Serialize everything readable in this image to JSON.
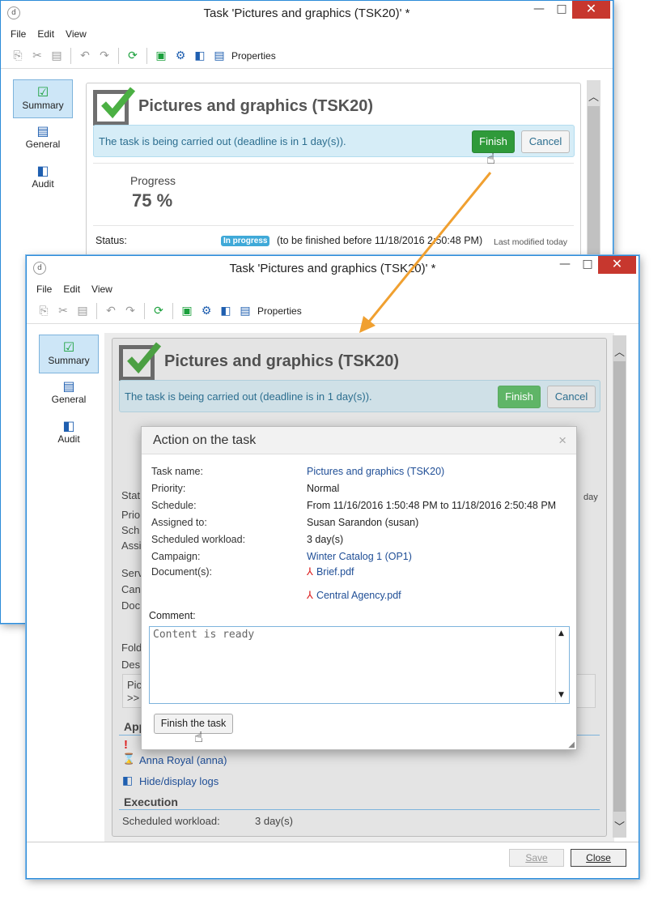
{
  "window_back": {
    "title": "Task 'Pictures and graphics (TSK20)' *",
    "menu": [
      "File",
      "Edit",
      "View"
    ],
    "toolbar_properties": "Properties",
    "sidebar": [
      {
        "label": "Summary"
      },
      {
        "label": "General"
      },
      {
        "label": "Audit"
      }
    ],
    "task_title": "Pictures and graphics (TSK20)",
    "info_text": "The task is being carried out (deadline is in 1 day(s)).",
    "finish_label": "Finish",
    "cancel_label": "Cancel",
    "progress_label": "Progress",
    "progress_value": "75 %",
    "status_label": "Status:",
    "status_badge": "In progress",
    "status_text": "(to be finished before 11/18/2016 2:50:48 PM)",
    "last_modified": "Last modified today",
    "minimize": "—",
    "maximize": "□",
    "close": "✕"
  },
  "window_front": {
    "title": "Task 'Pictures and graphics (TSK20)' *",
    "menu": [
      "File",
      "Edit",
      "View"
    ],
    "toolbar_properties": "Properties",
    "sidebar": [
      {
        "label": "Summary"
      },
      {
        "label": "General"
      },
      {
        "label": "Audit"
      }
    ],
    "task_title": "Pictures and graphics (TSK20)",
    "info_text": "The task is being carried out (deadline is in 1 day(s)).",
    "finish_label": "Finish",
    "cancel_label": "Cancel",
    "partial_labels": [
      "Stat",
      "Prio",
      "Sch",
      "Assi",
      "Serv",
      "Can",
      "Doc",
      "Fold",
      "Des",
      "Pic",
      ">>",
      "App"
    ],
    "partial_right": "day",
    "approver": "Anna Royal (anna)",
    "hide_logs": "Hide/display logs",
    "execution_heading": "Execution",
    "sched_workload_label": "Scheduled workload:",
    "sched_workload_value": "3 day(s)",
    "save_label": "Save",
    "close_label": "Close",
    "minimize": "—",
    "maximize": "□",
    "close": "✕"
  },
  "dialog": {
    "title": "Action on the task",
    "close_x": "×",
    "rows": [
      {
        "label": "Task name:",
        "value": "Pictures and graphics (TSK20)"
      },
      {
        "label": "Priority:",
        "value": "Normal"
      },
      {
        "label": "Schedule:",
        "value": "From 11/16/2016 1:50:48 PM to 11/18/2016 2:50:48 PM"
      },
      {
        "label": "Assigned to:",
        "value": "Susan Sarandon (susan)"
      },
      {
        "label": "Scheduled workload:",
        "value": "3 day(s)"
      },
      {
        "label": "Campaign:",
        "value": "Winter Catalog 1 (OP1)"
      },
      {
        "label": "Document(s):",
        "value": "Brief.pdf"
      }
    ],
    "doc2": "Central Agency.pdf",
    "comment_label": "Comment:",
    "comment_value": "Content is ready",
    "finish_task_label": "Finish the task"
  },
  "colors": {
    "accent": "#2b8bd8",
    "finish_green": "#2f9a3a",
    "arrow": "#f0a030",
    "link": "#1f4e96"
  }
}
